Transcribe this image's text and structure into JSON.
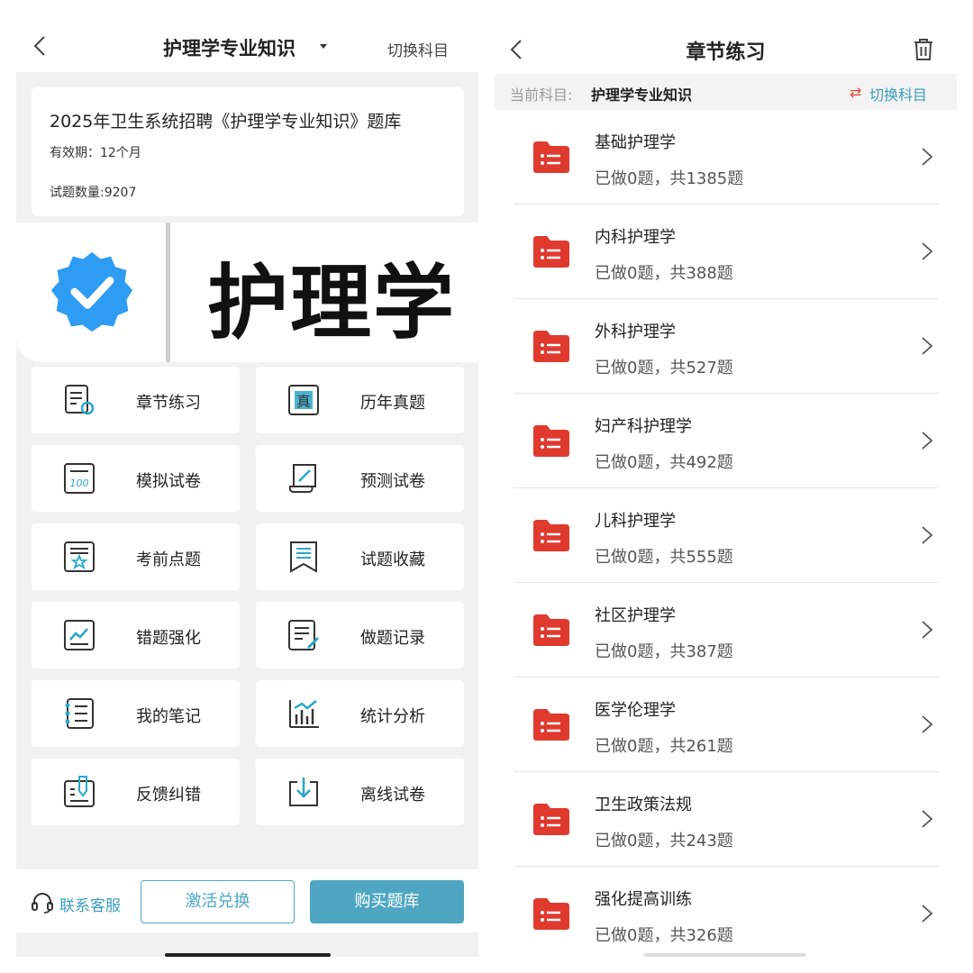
{
  "left": {
    "header": {
      "title": "护理学专业知识",
      "switch_label": "切换科目"
    },
    "info": {
      "title": "2025年卫生系统招聘《护理学专业知识》题库",
      "validity": "有效期：12个月",
      "count": "试题数量:9207"
    },
    "banner": {
      "text": "护理学"
    },
    "tiles": [
      {
        "label": "章节练习",
        "icon": "chapter-practice-icon"
      },
      {
        "label": "历年真题",
        "icon": "past-exams-icon"
      },
      {
        "label": "模拟试卷",
        "icon": "mock-paper-icon"
      },
      {
        "label": "预测试卷",
        "icon": "forecast-paper-icon"
      },
      {
        "label": "考前点题",
        "icon": "pre-exam-tips-icon"
      },
      {
        "label": "试题收藏",
        "icon": "bookmark-icon"
      },
      {
        "label": "错题强化",
        "icon": "mistake-review-icon"
      },
      {
        "label": "做题记录",
        "icon": "practice-record-icon"
      },
      {
        "label": "我的笔记",
        "icon": "notes-icon"
      },
      {
        "label": "统计分析",
        "icon": "statistics-icon"
      },
      {
        "label": "反馈纠错",
        "icon": "feedback-icon"
      },
      {
        "label": "离线试卷",
        "icon": "offline-download-icon"
      }
    ],
    "footer": {
      "service_label": "联系客服",
      "activate_label": "激活兑换",
      "buy_label": "购买题库"
    }
  },
  "right": {
    "header": {
      "title": "章节练习"
    },
    "subject": {
      "label": "当前科目:",
      "value": "护理学专业知识",
      "switch_label": "切换科目"
    },
    "chapters": [
      {
        "name": "基础护理学",
        "progress": "已做0题，共1385题"
      },
      {
        "name": "内科护理学",
        "progress": "已做0题，共388题"
      },
      {
        "name": "外科护理学",
        "progress": "已做0题，共527题"
      },
      {
        "name": "妇产科护理学",
        "progress": "已做0题，共492题"
      },
      {
        "name": "儿科护理学",
        "progress": "已做0题，共555题"
      },
      {
        "name": "社区护理学",
        "progress": "已做0题，共387题"
      },
      {
        "name": "医学伦理学",
        "progress": "已做0题，共261题"
      },
      {
        "name": "卫生政策法规",
        "progress": "已做0题，共243题"
      },
      {
        "name": "强化提高训练",
        "progress": "已做0题，共326题"
      }
    ]
  },
  "colors": {
    "accent": "#4ea6c2",
    "folder": "#e03a2f",
    "swap_icon": "#e24b3c"
  }
}
